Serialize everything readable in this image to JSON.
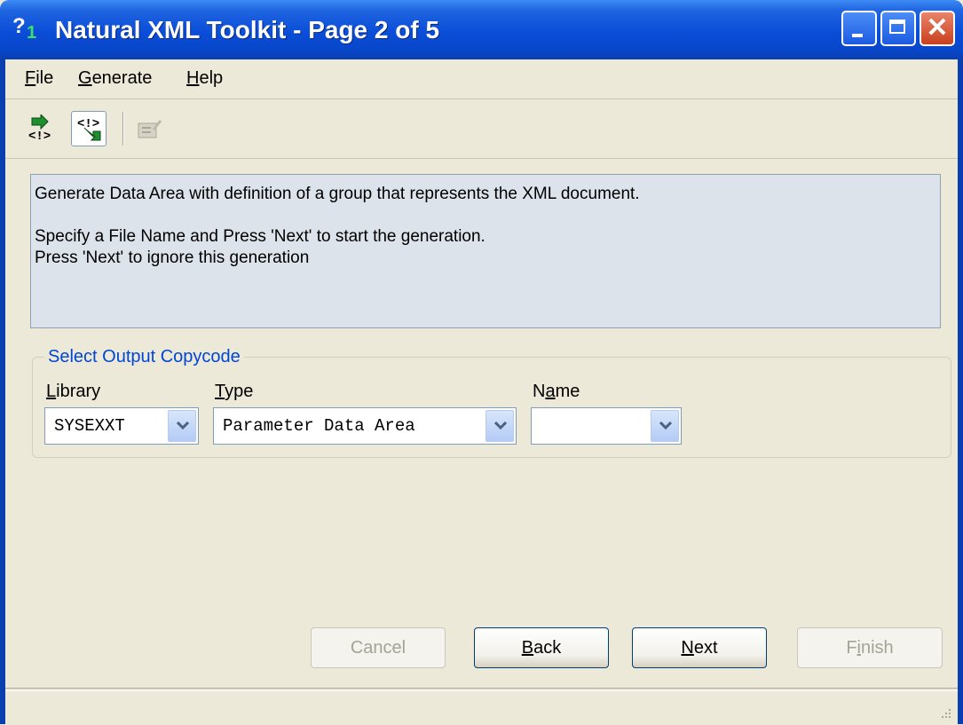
{
  "window": {
    "title": "Natural XML Toolkit - Page 2 of 5",
    "close_glyph": "✕"
  },
  "menu": {
    "items": [
      {
        "mnemonic": "F",
        "rest": "ile"
      },
      {
        "mnemonic": "G",
        "rest": "enerate"
      },
      {
        "mnemonic": "H",
        "rest": "elp"
      }
    ]
  },
  "toolbar": {
    "buttons": [
      "import-xml-icon",
      "generate-data-area-icon",
      "edit-disabled-icon"
    ]
  },
  "info": {
    "line1": "Generate Data Area with definition of a group that represents the XML document.",
    "line2": "Specify a File Name and Press 'Next' to start the generation.",
    "line3": "Press 'Next' to ignore this generation"
  },
  "output_group": {
    "title": "Select Output Copycode",
    "library": {
      "label_mnemonic": "L",
      "label_rest": "ibrary",
      "value": "SYSEXXT"
    },
    "type": {
      "label_mnemonic": "T",
      "label_rest": "ype",
      "value": "Parameter Data Area"
    },
    "name": {
      "label_pre": "N",
      "label_mnemonic": "a",
      "label_rest": "me",
      "value": ""
    }
  },
  "buttons": {
    "cancel": "Cancel",
    "back": {
      "mnemonic": "B",
      "rest": "ack"
    },
    "next": {
      "mnemonic": "N",
      "rest": "ext"
    },
    "finish": {
      "pre": "F",
      "mnemonic": "i",
      "rest": "nish"
    }
  },
  "colors": {
    "titlebar": "#0A4DD8",
    "group_title": "#0046D5",
    "info_bg": "#DCE3EA"
  }
}
